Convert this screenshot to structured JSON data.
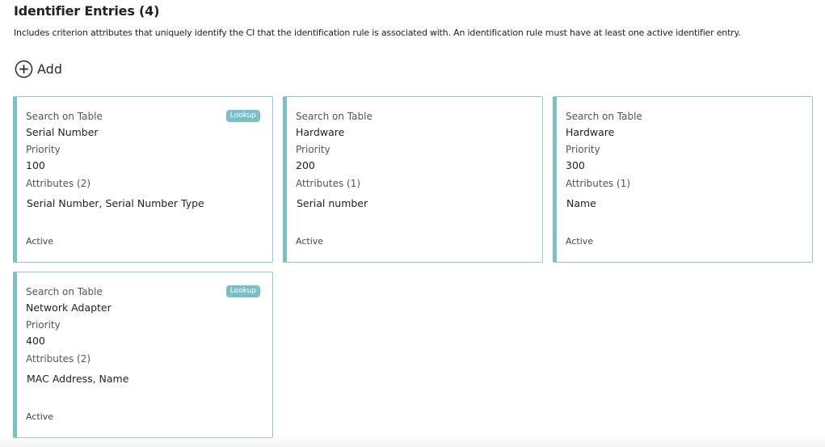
{
  "section": {
    "title": "Identifier Entries (4)",
    "description": "Includes criterion attributes that uniquely identify the CI that the identification rule is associated with. An identification rule must have at least one active identifier entry."
  },
  "add_button": {
    "label": "Add",
    "icon": "plus-circle-icon"
  },
  "colors": {
    "accent": "#7bbfc9",
    "badge_bg": "#79bfc8",
    "card_border": "#8fc7cf"
  },
  "cards": [
    {
      "table_label": "Search on Table",
      "table_value": "Serial Number",
      "priority_label": "Priority",
      "priority_value": "100",
      "attributes_label": "Attributes (2)",
      "attributes_value": "Serial Number, Serial Number Type",
      "status": "Active",
      "badge": "Lookup"
    },
    {
      "table_label": "Search on Table",
      "table_value": "Hardware",
      "priority_label": "Priority",
      "priority_value": "200",
      "attributes_label": "Attributes (1)",
      "attributes_value": "Serial number",
      "status": "Active",
      "badge": ""
    },
    {
      "table_label": "Search on Table",
      "table_value": "Hardware",
      "priority_label": "Priority",
      "priority_value": "300",
      "attributes_label": "Attributes (1)",
      "attributes_value": "Name",
      "status": "Active",
      "badge": ""
    },
    {
      "table_label": "Search on Table",
      "table_value": "Network Adapter",
      "priority_label": "Priority",
      "priority_value": "400",
      "attributes_label": "Attributes (2)",
      "attributes_value": "MAC Address, Name",
      "status": "Active",
      "badge": "Lookup"
    }
  ]
}
